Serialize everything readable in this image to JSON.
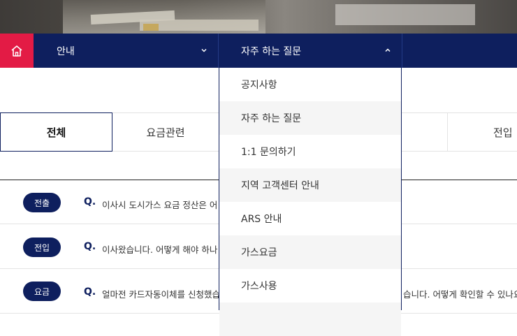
{
  "nav": {
    "home_icon": "home-icon",
    "menu1": {
      "label": "안내",
      "chevron": "chevron-down-icon"
    },
    "menu2": {
      "label": "자주 하는 질문",
      "chevron": "chevron-up-icon"
    }
  },
  "dropdown": {
    "items": [
      "공지사항",
      "자주 하는 질문",
      "1:1 문의하기",
      "지역 고객센터 안내",
      "ARS 안내",
      "가스요금",
      "가스사용"
    ]
  },
  "tabs": {
    "all": "전체",
    "fee": "요금관련",
    "movein": "전입"
  },
  "faq": {
    "q_mark": "Q.",
    "rows": [
      {
        "badge": "전출",
        "question": "이사시 도시가스 요금 정산은 어"
      },
      {
        "badge": "전입",
        "question": "이사왔습니다. 어떻게 해야 하나"
      },
      {
        "badge": "요금",
        "question": "얼마전 카드자동이체를 신청했습",
        "question_tail": "습니다. 어떻게 확인할 수 있나요"
      }
    ]
  },
  "colors": {
    "navy": "#0e1f5e",
    "red": "#e31b45"
  }
}
